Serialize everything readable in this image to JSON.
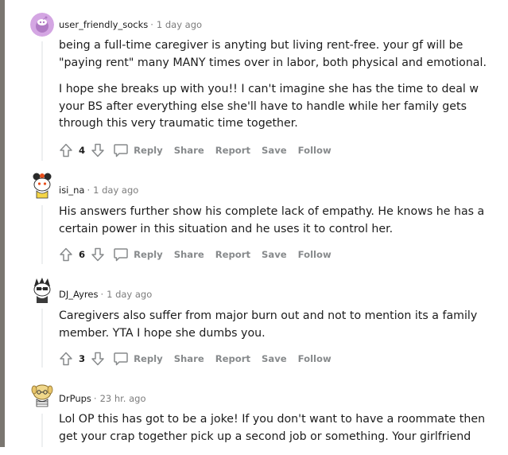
{
  "comments": [
    {
      "author": "user_friendly_socks",
      "time": "1 day ago",
      "paragraphs": [
        "being a full-time caregiver is anyting but living rent-free. your gf will be \"paying rent\" many MANY times over in labor, both physical and emotional.",
        "I hope she breaks up with you!! I can't imagine she has the time to deal w your BS after everything else she'll have to handle while her family gets through this very traumatic time together."
      ],
      "score": "4"
    },
    {
      "author": "isi_na",
      "time": "1 day ago",
      "paragraphs": [
        "His answers further show his complete lack of empathy. He knows he has a certain power in this situation and he uses it to control her."
      ],
      "score": "6"
    },
    {
      "author": "DJ_Ayres",
      "time": "1 day ago",
      "paragraphs": [
        "Caregivers also suffer from major burn out and not to mention its a family member. YTA I hope she dumbs you."
      ],
      "score": "3"
    },
    {
      "author": "DrPups",
      "time": "23 hr. ago",
      "paragraphs": [
        "Lol OP this has got to be a joke! If you don't want to have a roommate then get your crap together pick up a second job or something. Your girlfriend"
      ]
    }
  ],
  "actions": {
    "reply": "Reply",
    "share": "Share",
    "report": "Report",
    "save": "Save",
    "follow": "Follow"
  },
  "separator": "·",
  "colors": {
    "text": "#1c1c1c",
    "meta": "#7c7c7c",
    "action": "#878a8c",
    "rail": "#7a7670",
    "thread_line": "#edeff1"
  },
  "icons": [
    "upvote-icon",
    "downvote-icon",
    "comment-bubble-icon"
  ]
}
